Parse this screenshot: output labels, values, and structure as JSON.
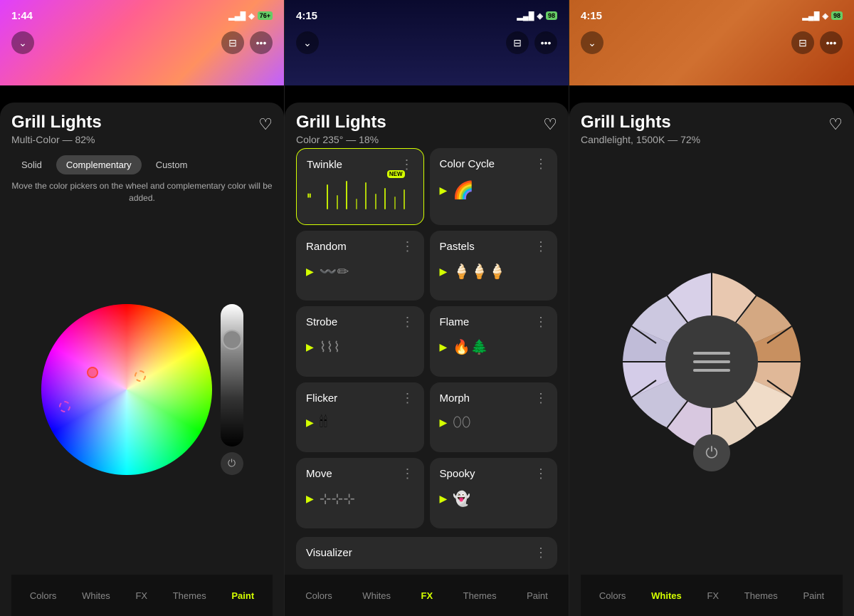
{
  "panels": [
    {
      "id": "panel-1",
      "status": {
        "time": "1:44",
        "signal": "●●●",
        "wifi": "wifi",
        "battery": "76+"
      },
      "header_gradient": "gradient-1",
      "top_bar": {
        "back_icon": "chevron-down",
        "save_icon": "bookmark",
        "more_icon": "ellipsis"
      },
      "title": "Grill Lights",
      "subtitle": "Multi-Color — 82%",
      "heart_icon": "heart",
      "segment_tabs": [
        "Solid",
        "Complementary",
        "Custom"
      ],
      "active_tab": "Complementary",
      "hint": "Move the color pickers on the wheel and complementary\ncolor will be added.",
      "nav_items": [
        "Colors",
        "Whites",
        "FX",
        "Themes",
        "Paint"
      ],
      "active_nav": "Paint"
    },
    {
      "id": "panel-2",
      "status": {
        "time": "4:15",
        "signal": "●●●",
        "wifi": "wifi",
        "battery": "98"
      },
      "header_gradient": "gradient-2",
      "title": "Grill Lights",
      "subtitle": "Color 235° — 18%",
      "fx_items": [
        {
          "name": "Twinkle",
          "icon": "sparkle",
          "active": true,
          "playing": false,
          "new": true
        },
        {
          "name": "Color Cycle",
          "icon": "rainbow",
          "active": false,
          "playing": true
        },
        {
          "name": "Random",
          "icon": "random",
          "active": false,
          "playing": true
        },
        {
          "name": "Pastels",
          "icon": "pastels",
          "active": false,
          "playing": true
        },
        {
          "name": "Strobe",
          "icon": "strobe",
          "active": false,
          "playing": true
        },
        {
          "name": "Flame",
          "icon": "flame",
          "active": false,
          "playing": true
        },
        {
          "name": "Flicker",
          "icon": "flicker",
          "active": false,
          "playing": true
        },
        {
          "name": "Morph",
          "icon": "morph",
          "active": false,
          "playing": true
        },
        {
          "name": "Move",
          "icon": "move",
          "active": false,
          "playing": true
        },
        {
          "name": "Spooky",
          "icon": "spooky",
          "active": false,
          "playing": true
        },
        {
          "name": "Visualizer",
          "icon": "visualizer",
          "active": false,
          "playing": true
        }
      ],
      "nav_items": [
        "Colors",
        "Whites",
        "FX",
        "Themes",
        "Paint"
      ],
      "active_nav": "FX"
    },
    {
      "id": "panel-3",
      "status": {
        "time": "4:15",
        "signal": "●●●",
        "wifi": "wifi",
        "battery": "98"
      },
      "header_gradient": "gradient-3",
      "title": "Grill Lights",
      "subtitle": "Candlelight, 1500K — 72%",
      "donut_segments": [
        {
          "color": "#e8c8b0",
          "label": "warm1"
        },
        {
          "color": "#d4a882",
          "label": "warm2"
        },
        {
          "color": "#c89060",
          "label": "warm3"
        },
        {
          "color": "#e0b898",
          "label": "warm4"
        },
        {
          "color": "#d8c8e0",
          "label": "cool1"
        },
        {
          "color": "#c8c4dc",
          "label": "cool2"
        },
        {
          "color": "#d4cce8",
          "label": "cool3"
        },
        {
          "color": "#c0bcd8",
          "label": "cool4"
        },
        {
          "color": "#e8d4c0",
          "label": "neutral1"
        },
        {
          "color": "#f0d8b8",
          "label": "neutral2"
        },
        {
          "color": "#e0c8a8",
          "label": "neutral3"
        },
        {
          "color": "#ecd0b0",
          "label": "neutral4"
        }
      ],
      "nav_items": [
        "Colors",
        "Whites",
        "FX",
        "Themes",
        "Paint"
      ],
      "active_nav": "Whites"
    }
  ]
}
